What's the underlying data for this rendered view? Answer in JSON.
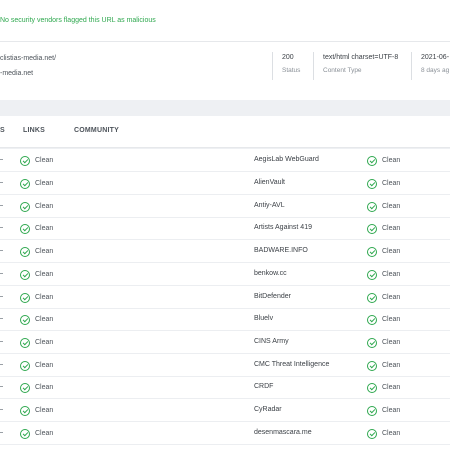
{
  "banner": {
    "text": "No security vendors flagged this URL as malicious"
  },
  "url_info": {
    "url_line1": "clistias-media.net/",
    "url_line2": "-media.net"
  },
  "stats": [
    {
      "value": "200",
      "label": "Status"
    },
    {
      "value": "text/html charset=UTF-8",
      "label": "Content Type"
    },
    {
      "value": "2021-06-",
      "label": "8 days ag"
    }
  ],
  "tabs": [
    {
      "label": "S"
    },
    {
      "label": "LINKS"
    },
    {
      "label": "COMMUNITY"
    }
  ],
  "rows": [
    {
      "left_result": "Clean",
      "vendor": "AegisLab WebGuard",
      "right_result": "Clean"
    },
    {
      "left_result": "Clean",
      "vendor": "AlienVault",
      "right_result": "Clean"
    },
    {
      "left_result": "Clean",
      "vendor": "Antiy-AVL",
      "right_result": "Clean"
    },
    {
      "left_result": "Clean",
      "vendor": "Artists Against 419",
      "right_result": "Clean"
    },
    {
      "left_result": "Clean",
      "vendor": "BADWARE.INFO",
      "right_result": "Clean"
    },
    {
      "left_result": "Clean",
      "vendor": "benkow.cc",
      "right_result": "Clean"
    },
    {
      "left_result": "Clean",
      "vendor": "BitDefender",
      "right_result": "Clean"
    },
    {
      "left_result": "Clean",
      "vendor": "Bluelv",
      "right_result": "Clean"
    },
    {
      "left_result": "Clean",
      "vendor": "CINS Army",
      "right_result": "Clean"
    },
    {
      "left_result": "Clean",
      "vendor": "CMC Threat Intelligence",
      "right_result": "Clean"
    },
    {
      "left_result": "Clean",
      "vendor": "CRDF",
      "right_result": "Clean"
    },
    {
      "left_result": "Clean",
      "vendor": "CyRadar",
      "right_result": "Clean"
    },
    {
      "left_result": "Clean",
      "vendor": "desenmascara.me",
      "right_result": "Clean"
    }
  ],
  "colors": {
    "clean": "#2fa84f",
    "text": "#3a3f45",
    "muted": "#8a9097"
  },
  "icons": {
    "result_icon": "check-circle-icon"
  }
}
